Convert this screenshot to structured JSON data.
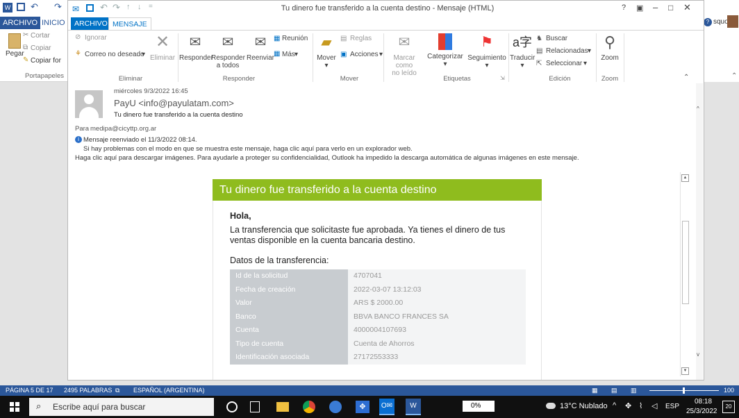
{
  "colors": {
    "word_blue": "#2b579a",
    "outlook_blue": "#0072c6",
    "email_green": "#8fbc1e"
  },
  "word": {
    "tabs": [
      "ARCHIVO",
      "INICIO"
    ],
    "ribbon": {
      "paste_label": "Pegar",
      "cut_label": "Cortar",
      "copy_label": "Copiar",
      "format_label": "Copiar for",
      "group_label": "Portapapeles"
    },
    "right_text": "squo",
    "status": {
      "page": "PÁGINA 5 DE 17",
      "words": "2495 PALABRAS",
      "language": "ESPAÑOL (ARGENTINA)",
      "zoom": "100 %"
    }
  },
  "outlook": {
    "title": "Tu dinero fue transferido a la cuenta destino - Mensaje (HTML)",
    "tabs": [
      "ARCHIVO",
      "MENSAJE"
    ],
    "ribbon": {
      "eliminar": {
        "ignorar": "Ignorar",
        "correo_no_deseado": "Correo no deseado",
        "eliminar": "Eliminar",
        "group": "Eliminar"
      },
      "responder": {
        "responder": "Responder",
        "responder_todos_1": "Responder",
        "responder_todos_2": "a todos",
        "reenviar": "Reenviar",
        "reunion": "Reunión",
        "mas": "Más",
        "group": "Responder"
      },
      "mover": {
        "mover": "Mover",
        "reglas": "Reglas",
        "acciones": "Acciones",
        "group": "Mover"
      },
      "etiquetas": {
        "marcar_1": "Marcar como",
        "marcar_2": "no leído",
        "categorizar": "Categorizar",
        "seguimiento": "Seguimiento",
        "group": "Etiquetas"
      },
      "edicion": {
        "traducir": "Traducir",
        "buscar": "Buscar",
        "relacionadas": "Relacionadas",
        "seleccionar": "Seleccionar",
        "group": "Edición"
      },
      "zoom": {
        "zoom": "Zoom",
        "group": "Zoom"
      }
    },
    "header": {
      "date": "miércoles 9/3/2022 16:45",
      "sender": "PayU <info@payulatam.com>",
      "subject": "Tu dinero fue transferido a la cuenta destino",
      "to_label": "Para",
      "to": "medipa@cicyttp.org.ar",
      "forwarded": "Mensaje reenviado el 11/3/2022 08:14.",
      "info1": "Si hay problemas con el modo en que se muestra este mensaje, haga clic aquí para verlo en un explorador web.",
      "info2": "Haga clic aquí para descargar imágenes. Para ayudarle a proteger su confidencialidad, Outlook ha impedido la descarga automática de algunas imágenes en este mensaje."
    },
    "email": {
      "banner": "Tu dinero fue transferido a la cuenta destino",
      "greeting": "Hola,",
      "paragraph": "La transferencia que solicitaste fue aprobada. Ya tienes el dinero de tus ventas disponible en la cuenta bancaria destino.",
      "section_title": "Datos de la transferencia:",
      "rows": [
        {
          "label": "Id de la solicitud",
          "value": "4707041"
        },
        {
          "label": "Fecha de creación",
          "value": "2022-03-07 13:12:03"
        },
        {
          "label": "Valor",
          "value": "ARS $ 2000.00"
        },
        {
          "label": "Banco",
          "value": "BBVA BANCO FRANCES SA"
        },
        {
          "label": "Cuenta",
          "value": "4000004107693"
        },
        {
          "label": "Tipo de cuenta",
          "value": "Cuenta de Ahorros"
        },
        {
          "label": "Identificación asociada",
          "value": "27172553333"
        }
      ]
    }
  },
  "taskbar": {
    "search_placeholder": "Escribe aquí para buscar",
    "progress_label": "0%",
    "weather": "13°C Nublado",
    "lang": "ESP",
    "time": "08:18",
    "date": "25/3/2022",
    "notifications": "20"
  }
}
